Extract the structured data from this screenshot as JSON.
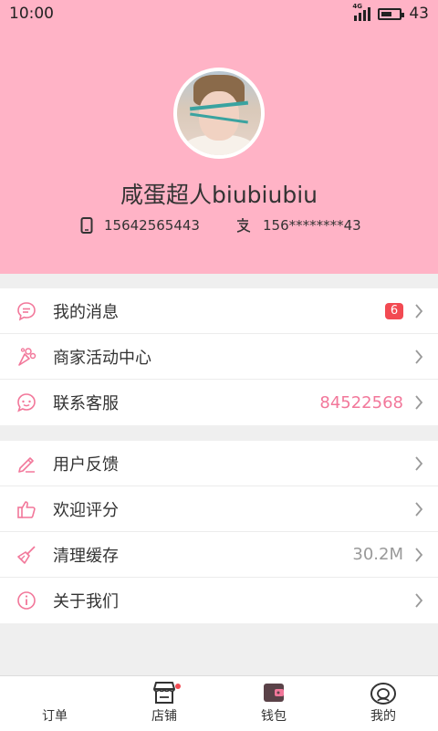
{
  "status_bar": {
    "time": "10:00",
    "network": "4G",
    "battery": "43",
    "battery_level": 0.6
  },
  "profile": {
    "username": "咸蛋超人biubiubiu",
    "phone": "15642565443",
    "alipay": "156********43"
  },
  "menu_group1": [
    {
      "label": "我的消息",
      "badge": "6",
      "icon": "message-icon"
    },
    {
      "label": "商家活动中心",
      "icon": "activity-icon"
    },
    {
      "label": "联系客服",
      "value": "84522568",
      "icon": "service-icon"
    }
  ],
  "menu_group2": [
    {
      "label": "用户反馈",
      "icon": "feedback-icon"
    },
    {
      "label": "欢迎评分",
      "icon": "thumbs-up-icon"
    },
    {
      "label": "清理缓存",
      "value": "30.2M",
      "icon": "broom-icon"
    },
    {
      "label": "关于我们",
      "icon": "info-icon"
    }
  ],
  "tabs": [
    {
      "label": "订单",
      "icon": ""
    },
    {
      "label": "店铺",
      "icon": "store-icon"
    },
    {
      "label": "钱包",
      "icon": "wallet-icon"
    },
    {
      "label": "我的",
      "icon": "profile-icon"
    }
  ],
  "colors": {
    "header_bg": "#ffb3c6",
    "accent": "#f2779a",
    "badge": "#f24a52"
  }
}
